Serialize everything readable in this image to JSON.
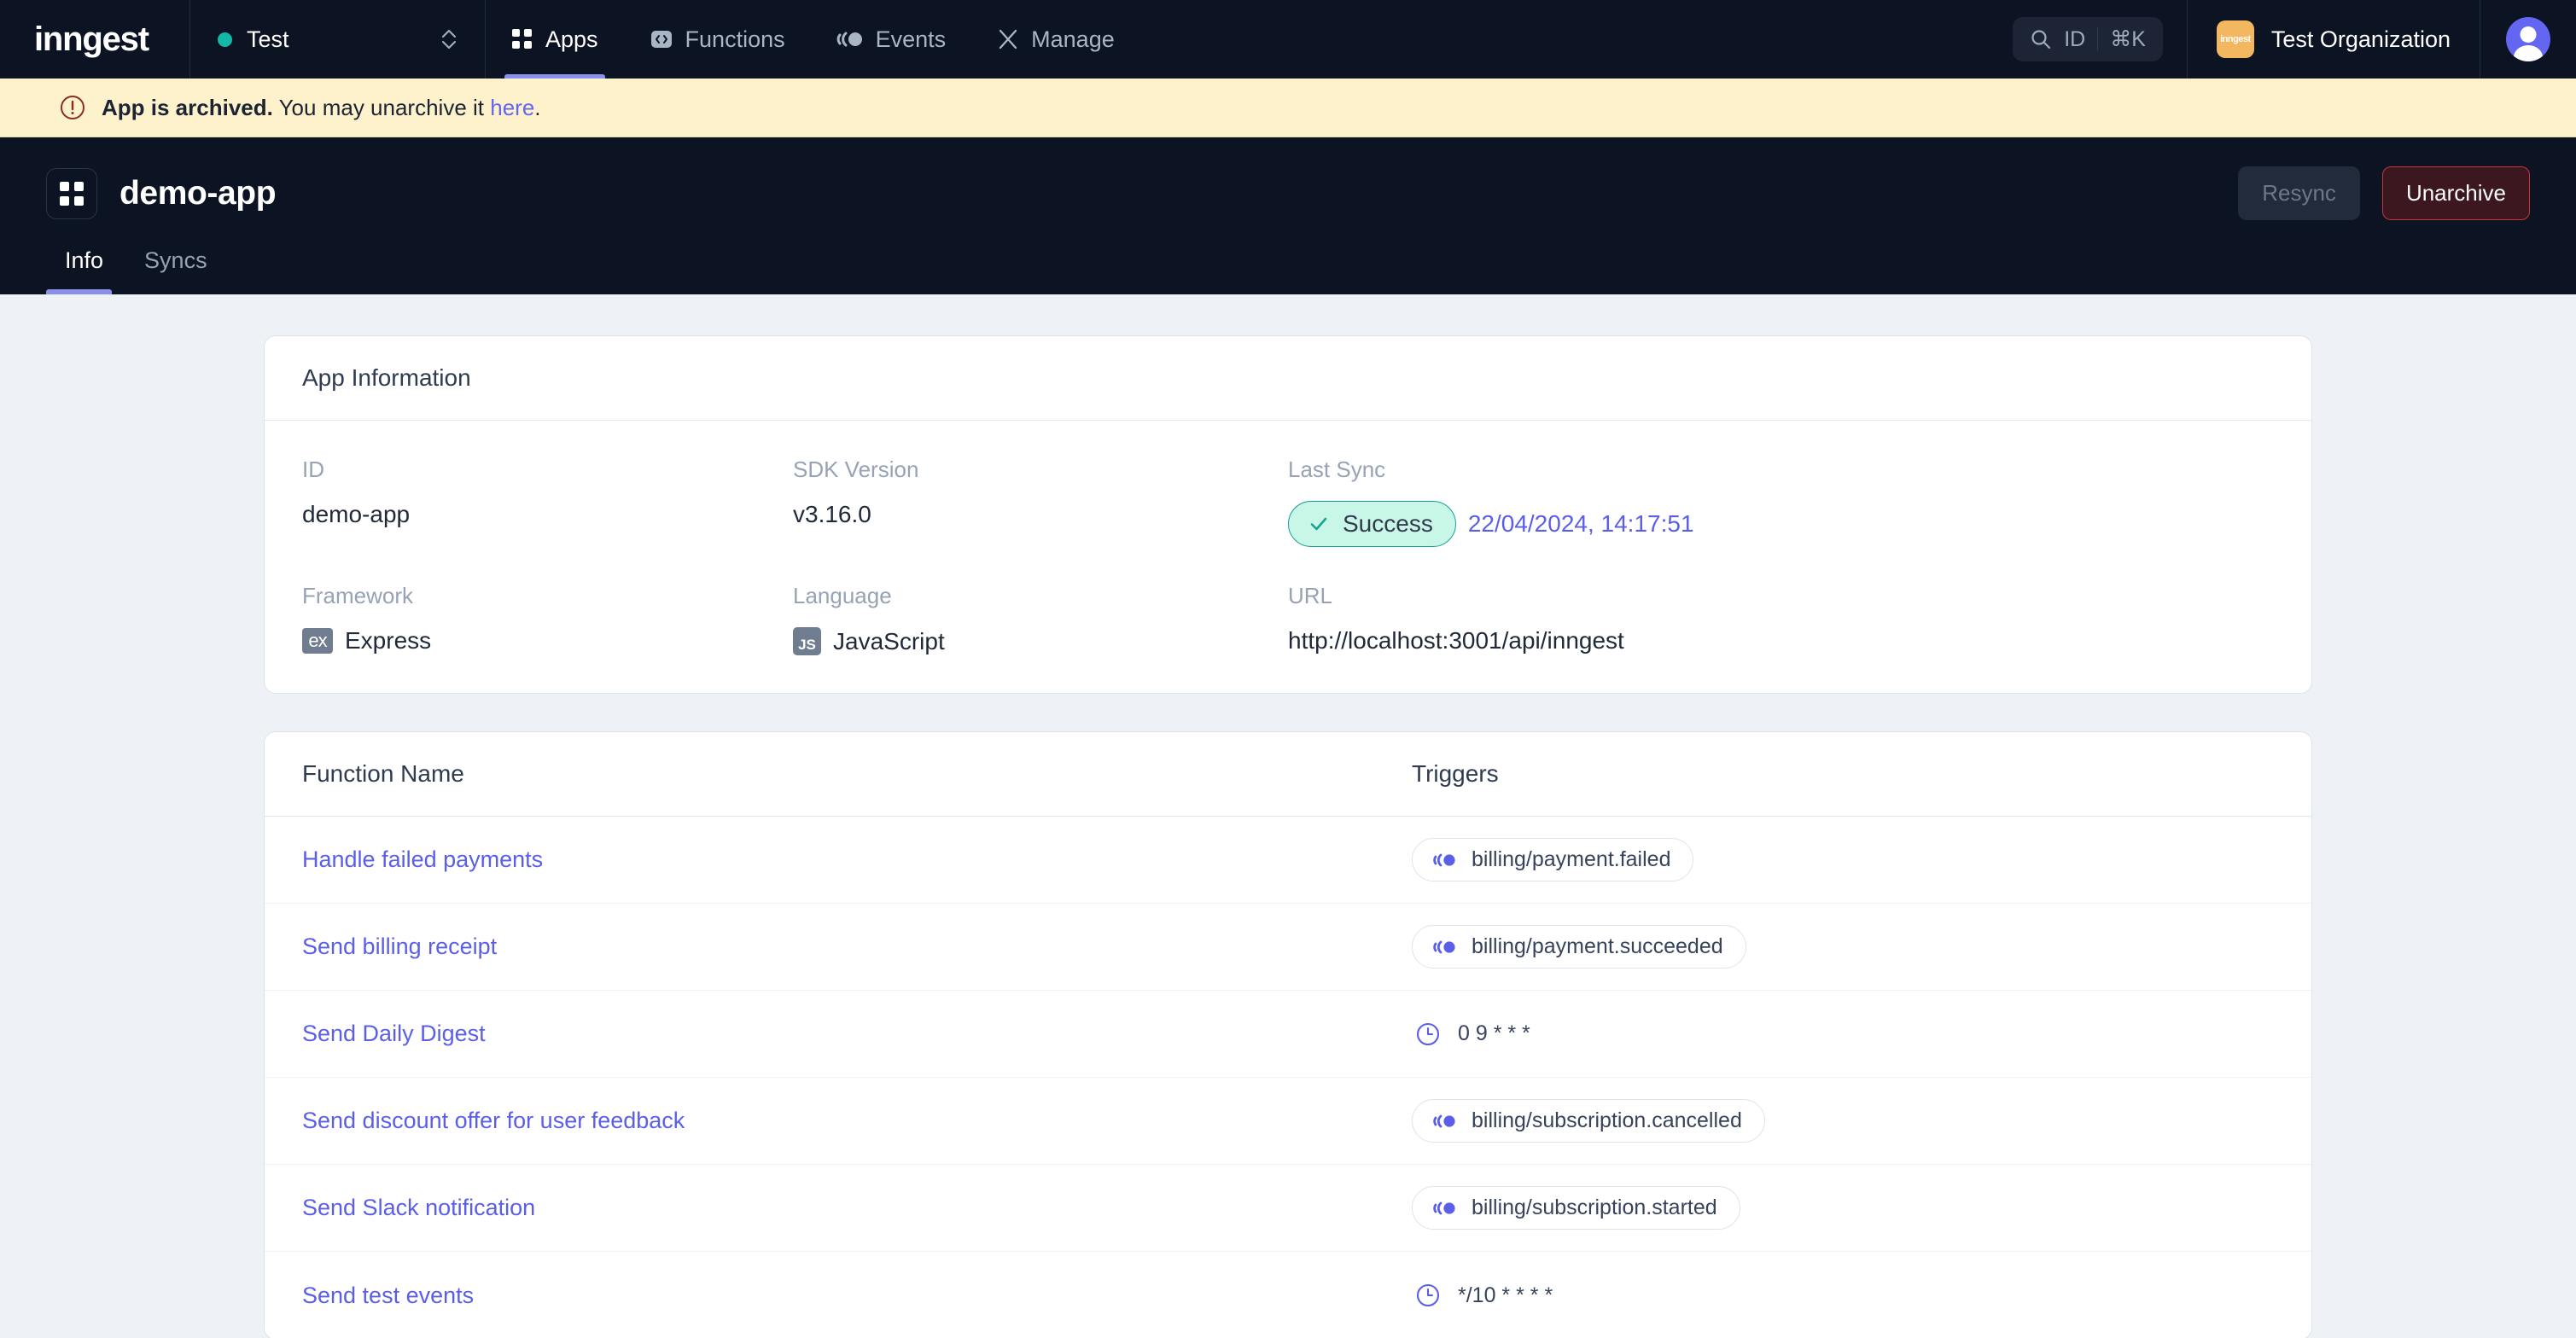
{
  "nav": {
    "logo": "inngest",
    "environment": "Test",
    "items": [
      {
        "label": "Apps",
        "icon": "grid-icon",
        "active": true
      },
      {
        "label": "Functions",
        "icon": "code-icon",
        "active": false
      },
      {
        "label": "Events",
        "icon": "events-icon",
        "active": false
      },
      {
        "label": "Manage",
        "icon": "scissors-icon",
        "active": false
      }
    ],
    "search": {
      "label": "ID",
      "shortcut": "⌘K"
    },
    "organization": "Test Organization",
    "org_logo_text": "inngest"
  },
  "banner": {
    "bold": "App is archived.",
    "text": " You may unarchive it ",
    "link": "here",
    "suffix": "."
  },
  "app_header": {
    "title": "demo-app",
    "resync_label": "Resync",
    "unarchive_label": "Unarchive",
    "tabs": [
      {
        "label": "Info",
        "active": true
      },
      {
        "label": "Syncs",
        "active": false
      }
    ]
  },
  "app_information": {
    "card_title": "App Information",
    "fields": [
      {
        "label": "ID",
        "value": "demo-app"
      },
      {
        "label": "SDK Version",
        "value": "v3.16.0"
      },
      {
        "label": "Last Sync",
        "status": "Success",
        "timestamp": "22/04/2024, 14:17:51"
      },
      {
        "label": "Framework",
        "value": "Express",
        "badge": "ex"
      },
      {
        "label": "Language",
        "value": "JavaScript",
        "badge": "JS"
      },
      {
        "label": "URL",
        "value": "http://localhost:3001/api/inngest"
      }
    ]
  },
  "functions": {
    "columns": {
      "name": "Function Name",
      "triggers": "Triggers"
    },
    "rows": [
      {
        "name": "Handle failed payments",
        "trigger": "billing/payment.failed",
        "type": "event"
      },
      {
        "name": "Send billing receipt",
        "trigger": "billing/payment.succeeded",
        "type": "event"
      },
      {
        "name": "Send Daily Digest",
        "trigger": "0 9 * * *",
        "type": "cron"
      },
      {
        "name": "Send discount offer for user feedback",
        "trigger": "billing/subscription.cancelled",
        "type": "event"
      },
      {
        "name": "Send Slack notification",
        "trigger": "billing/subscription.started",
        "type": "event"
      },
      {
        "name": "Send test events",
        "trigger": "*/10 * * * *",
        "type": "cron"
      }
    ]
  },
  "colors": {
    "nav_bg": "#0c1322",
    "page_bg": "#eef1f6",
    "accent": "#5b5fe8",
    "banner_bg": "#fdf2cc",
    "success": "#16a394",
    "danger": "#c5353a",
    "env_dot": "#14b8a6"
  }
}
